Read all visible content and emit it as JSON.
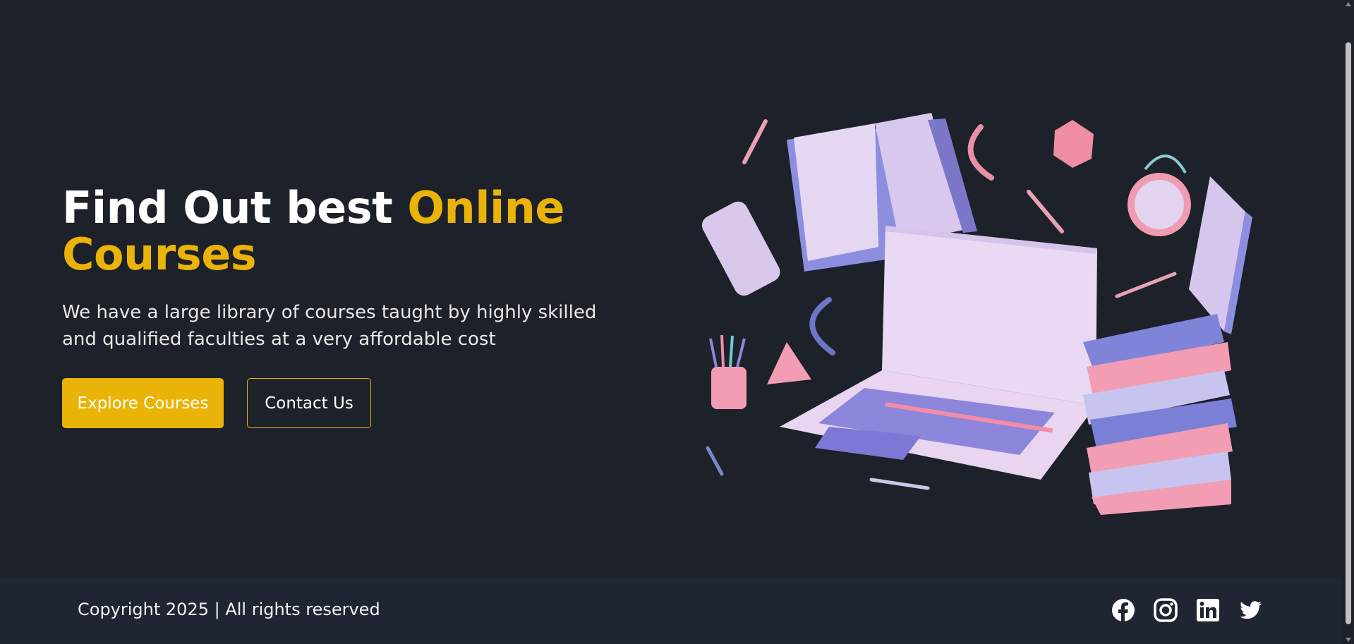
{
  "hero": {
    "headline_plain": "Find Out best ",
    "headline_highlight": "Online Courses",
    "subtitle": "We have a large library of courses taught by highly skilled and qualified faculties at a very affordable cost",
    "primary_button": "Explore Courses",
    "secondary_button": "Contact Us",
    "illustration": "laptop-books-study-illustration"
  },
  "footer": {
    "copyright": "Copyright 2025 | All rights reserved",
    "socials": [
      "facebook-icon",
      "instagram-icon",
      "linkedin-icon",
      "twitter-icon"
    ]
  },
  "colors": {
    "background": "#1d2129",
    "footer_background": "#1f2533",
    "accent": "#eab308",
    "text": "#ffffff"
  }
}
